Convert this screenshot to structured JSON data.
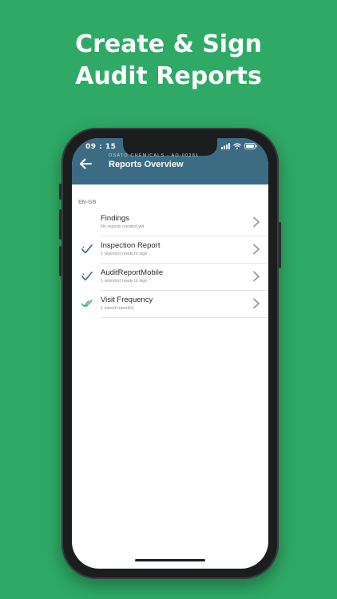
{
  "headline": {
    "line1": "Create & Sign",
    "line2": "Audit Reports"
  },
  "status_bar": {
    "time": "09 : 15",
    "icons": [
      "signal-icon",
      "wifi-icon",
      "battery-icon"
    ]
  },
  "app_bar": {
    "subtitle": "OSATO CHEMICALS - AO-00281",
    "title": "Reports Overview",
    "back_icon": "arrow-left-icon",
    "color": "#3c6c84"
  },
  "locale_label": "EN-GB",
  "reports": [
    {
      "title": "Findings",
      "status": "No reports created yet",
      "icon": "none"
    },
    {
      "title": "Inspection Report",
      "status": "1 report(s) ready to sign",
      "icon": "signature-check-icon"
    },
    {
      "title": "AuditReportMobile",
      "status": "1 report(s) ready to sign",
      "icon": "signature-check-icon"
    },
    {
      "title": "Visit Frequency",
      "status": "1 saved report(s)",
      "icon": "double-check-icon"
    }
  ],
  "colors": {
    "background": "#2eaa66",
    "check_blue": "#3c6c84",
    "check_green": "#2eaa66"
  }
}
